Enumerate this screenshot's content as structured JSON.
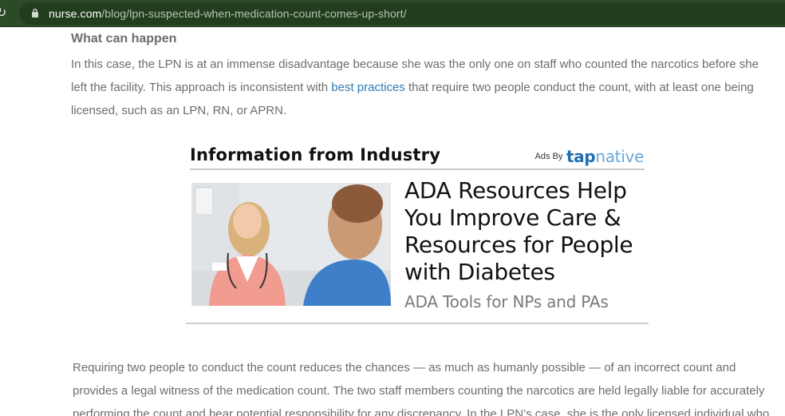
{
  "browser": {
    "url_host": "nurse.com",
    "url_path": "/blog/lpn-suspected-when-medication-count-comes-up-short/"
  },
  "article": {
    "section_heading": "What can happen",
    "para1_before_link": "In this case, the LPN is at an immense disadvantage because she was the only one on staff who counted the narcotics before she left the facility. This approach is inconsistent with ",
    "para1_link": "best practices",
    "para1_after_link": " that require two people conduct the count, with at least one being licensed, such as an LPN, RN, or APRN.",
    "para2": "Requiring two people to conduct the count reduces the chances — as much as humanly possible — of an incorrect count and provides a legal witness of the medication count. The two staff members counting the narcotics are held legally liable for accurately performing the count and bear potential responsibility for any discrepancy. In the LPN’s case, she is the only licensed individual who"
  },
  "ad": {
    "title": "Information from Industry",
    "ads_by_label": "Ads By",
    "logo_part1": "tap",
    "logo_part2": "native",
    "headline": "ADA Resources Help You Improve Care & Resources for People with Diabetes",
    "subline": "ADA Tools for NPs and PAs"
  },
  "colors": {
    "addressbar": "#2b4a26",
    "link": "#2c7bb6",
    "body_text": "#6d6d6d",
    "tapnative_dark": "#1f6fb0",
    "tapnative_light": "#6aa7d8"
  },
  "icons": {
    "reload": "reload-icon",
    "lock": "lock-icon"
  }
}
